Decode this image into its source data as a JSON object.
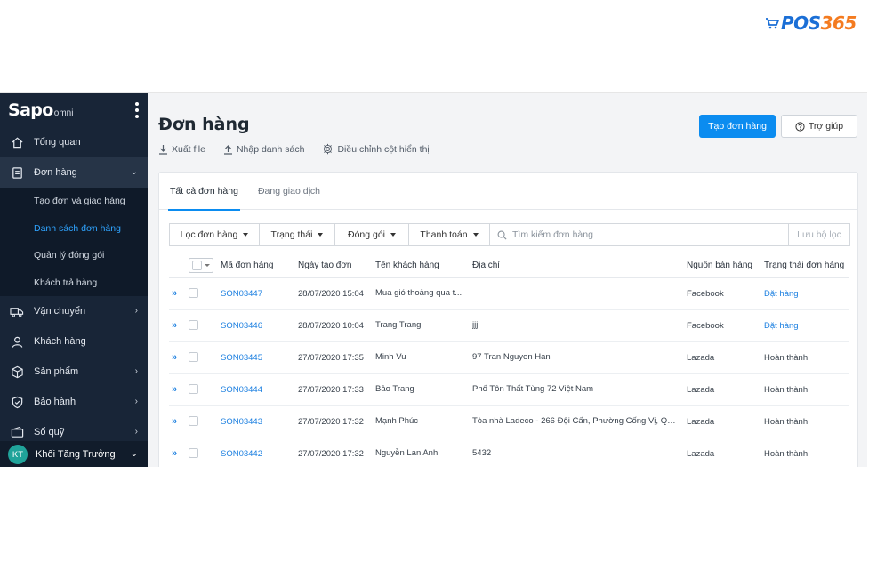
{
  "brand": {
    "logo_pos": "POS",
    "logo_num": "365",
    "sapo": "Sapo",
    "omni": "omni"
  },
  "sidebar": {
    "items": [
      {
        "label": "Tổng quan",
        "icon": "home-icon"
      },
      {
        "label": "Đơn hàng",
        "icon": "order-icon",
        "active": true
      },
      {
        "label": "Vận chuyển",
        "icon": "truck-icon"
      },
      {
        "label": "Khách hàng",
        "icon": "user-icon"
      },
      {
        "label": "Sản phẩm",
        "icon": "box-icon"
      },
      {
        "label": "Bảo hành",
        "icon": "shield-icon"
      },
      {
        "label": "Sổ quỹ",
        "icon": "wallet-icon"
      }
    ],
    "subitems": [
      "Tạo đơn và giao hàng",
      "Danh sách đơn hàng",
      "Quản lý đóng gói",
      "Khách trả hàng"
    ],
    "user": {
      "initials": "KT",
      "name": "Khối Tăng Trưởng"
    }
  },
  "page": {
    "title": "Đơn hàng",
    "actions": [
      "Xuất file",
      "Nhập danh sách",
      "Điều chỉnh cột hiển thị"
    ],
    "create_button": "Tạo đơn hàng",
    "help_button": "Trợ giúp"
  },
  "tabs": [
    "Tất cả đơn hàng",
    "Đang giao dịch"
  ],
  "filters": {
    "order_filter": "Lọc đơn hàng",
    "status": "Trạng thái",
    "packing": "Đóng gói",
    "payment": "Thanh toán",
    "search_placeholder": "Tìm kiếm đơn hàng",
    "save_filter": "Lưu bộ lọc"
  },
  "table": {
    "headers": [
      "Mã đơn hàng",
      "Ngày tạo đơn",
      "Tên khách hàng",
      "Địa chỉ",
      "Nguồn bán hàng",
      "Trạng thái đơn hàng"
    ],
    "rows": [
      {
        "code": "SON03447",
        "date": "28/07/2020 15:04",
        "customer": "Mua gió thoảng qua t...",
        "address": "",
        "source": "Facebook",
        "status": "Đặt hàng",
        "status_blue": true
      },
      {
        "code": "SON03446",
        "date": "28/07/2020 10:04",
        "customer": "Trang Trang",
        "address": "jjj",
        "source": "Facebook",
        "status": "Đặt hàng",
        "status_blue": true
      },
      {
        "code": "SON03445",
        "date": "27/07/2020 17:35",
        "customer": "Minh Vu",
        "address": "97 Tran Nguyen Han",
        "source": "Lazada",
        "status": "Hoàn thành",
        "status_blue": false
      },
      {
        "code": "SON03444",
        "date": "27/07/2020 17:33",
        "customer": "Bảo Trang",
        "address": "Phố Tôn Thất Tùng 72 Việt Nam",
        "source": "Lazada",
        "status": "Hoàn thành",
        "status_blue": false
      },
      {
        "code": "SON03443",
        "date": "27/07/2020 17:32",
        "customer": "Mạnh Phúc",
        "address": "Tòa nhà Ladeco - 266 Đội Cấn, Phường Cống Vị, Quận...",
        "source": "Lazada",
        "status": "Hoàn thành",
        "status_blue": false
      },
      {
        "code": "SON03442",
        "date": "27/07/2020 17:32",
        "customer": "Nguyễn Lan Anh",
        "address": "5432",
        "source": "Lazada",
        "status": "Hoàn thành",
        "status_blue": false
      }
    ]
  },
  "colors": {
    "sidebar_bg": "#182537",
    "accent": "#0b8cf0",
    "link": "#1b7fe0"
  }
}
